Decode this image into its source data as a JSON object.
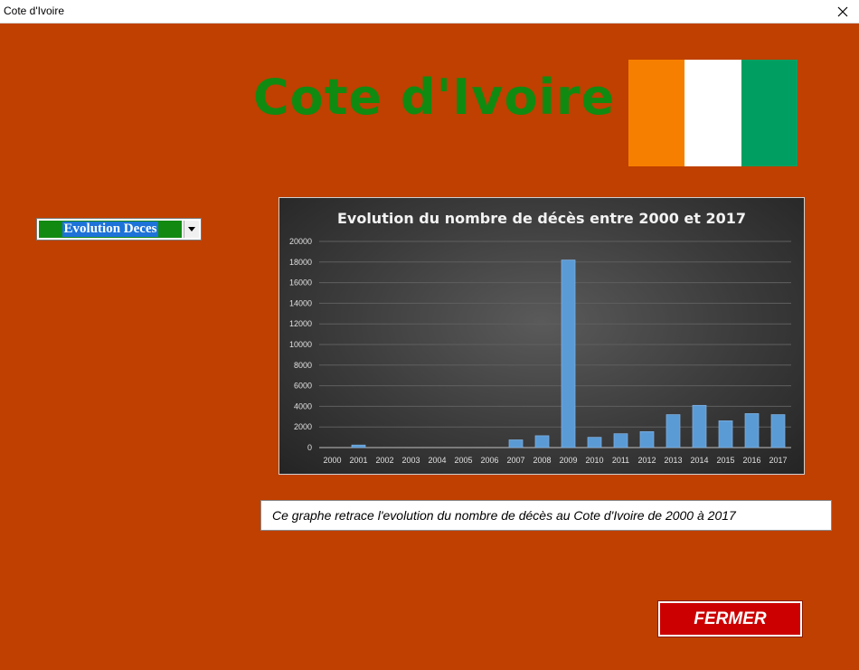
{
  "window": {
    "title": "Cote d'Ivoire"
  },
  "page": {
    "heading": "Cote d'Ivoire",
    "flag_colors": [
      "#f77f00",
      "#ffffff",
      "#009e60"
    ]
  },
  "selector": {
    "value": "Evolution Deces"
  },
  "chart_data": {
    "type": "bar",
    "title": "Evolution du nombre de décès entre 2000 et 2017",
    "categories": [
      "2000",
      "2001",
      "2002",
      "2003",
      "2004",
      "2005",
      "2006",
      "2007",
      "2008",
      "2009",
      "2010",
      "2011",
      "2012",
      "2013",
      "2014",
      "2015",
      "2016",
      "2017"
    ],
    "values": [
      0,
      250,
      0,
      0,
      0,
      0,
      0,
      750,
      1150,
      18200,
      1000,
      1350,
      1550,
      3200,
      4100,
      2600,
      3300,
      3200
    ],
    "ylim": [
      0,
      20000
    ],
    "yticks": [
      0,
      2000,
      4000,
      6000,
      8000,
      10000,
      12000,
      14000,
      16000,
      18000,
      20000
    ],
    "grid": true,
    "bar_color": "#5b9bd5"
  },
  "caption": "Ce graphe retrace l'evolution du nombre de décès au Cote d'Ivoire de 2000 à 2017",
  "buttons": {
    "close": "FERMER"
  }
}
